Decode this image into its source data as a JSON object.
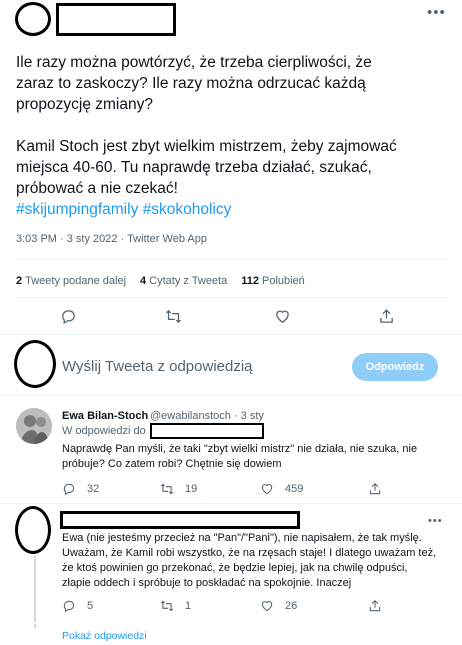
{
  "main_tweet": {
    "text_lines": [
      "Ile razy można powtórzyć, że trzeba cierpliwości, że",
      "zaraz to zaskoczy? Ile razy można odrzucać każdą",
      "propozycję zmiany?",
      "",
      "Kamil Stoch jest zbyt wielkim mistrzem, żeby zajmować",
      "miejsca 40-60. Tu naprawdę trzeba działać, szukać,",
      "próbować a nie czekać!"
    ],
    "hashtags": "#skijumpingfamily #skokoholicy",
    "timestamp": "3:03 PM · 3 sty 2022 · Twitter Web App",
    "stats": {
      "retweets_count": "2",
      "retweets_label": "Tweety podane dalej",
      "quotes_count": "4",
      "quotes_label": "Cytaty z Tweeta",
      "likes_count": "112",
      "likes_label": "Polubień"
    }
  },
  "reply_box": {
    "placeholder": "Wyślij Tweeta z odpowiedzią",
    "button_label": "Odpowiedz"
  },
  "replies": [
    {
      "name": "Ewa Bilan-Stoch",
      "handle": "@ewabilanstoch · 3 sty",
      "reply_to_prefix": "W odpowiedzi do",
      "text_lines": [
        "Naprawdę Pan myśli, że taki \"zbyt wielki mistrz\" nie działa, nie szuka, nie",
        "próbuje? Co zatem robi? Chętnie się dowiem"
      ],
      "replies_count": "32",
      "retweets_count": "19",
      "likes_count": "459"
    },
    {
      "text_lines": [
        "Ewa (nie jesteśmy przecież na \"Pan\"/\"Pani\"), nie napisałem, że tak myślę.",
        "Uważam, że Kamil robi wszystko, że na rzęsach staje! I dlatego uważam też,",
        "że ktoś powinien go przekonać, że będzie lepiej, jak na chwilę odpuści,",
        "złapie oddech i spróbuje to poskładać na spokojnie. Inaczej"
      ],
      "replies_count": "5",
      "retweets_count": "1",
      "likes_count": "26"
    }
  ],
  "show_replies_label": "Pokaż odpowiedzi",
  "colors": {
    "accent": "#1d9bf0",
    "muted_text": "#536471",
    "reply_button_bg": "#8ecdf8",
    "divider": "#eff3f4"
  },
  "icons": [
    "more-icon",
    "reply-icon",
    "retweet-icon",
    "like-icon",
    "share-icon"
  ]
}
